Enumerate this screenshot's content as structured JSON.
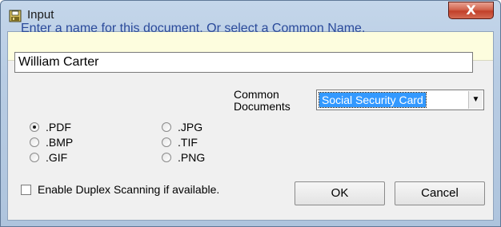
{
  "window": {
    "title": "Input",
    "close_glyph": "X"
  },
  "prompt": {
    "text": "Enter a name for this document.  Or select a Common Name."
  },
  "name_field": {
    "value": "William Carter"
  },
  "formats": {
    "col1": [
      {
        "label": ".PDF",
        "selected": true
      },
      {
        "label": ".BMP",
        "selected": false
      },
      {
        "label": ".GIF",
        "selected": false
      }
    ],
    "col2": [
      {
        "label": ".JPG",
        "selected": false
      },
      {
        "label": ".TIF",
        "selected": false
      },
      {
        "label": ".PNG",
        "selected": false
      }
    ]
  },
  "common": {
    "label_line1": "Common",
    "label_line2": "Documents",
    "selected": "Social Security Card"
  },
  "duplex": {
    "label": "Enable Duplex Scanning if available.",
    "checked": false
  },
  "buttons": {
    "ok": "OK",
    "cancel": "Cancel"
  },
  "icons": {
    "app": "scanner-floppy-icon",
    "dropdown": "chevron-down-icon"
  },
  "colors": {
    "prompt_text": "#2a4a9a",
    "prompt_bg": "#fdfdde",
    "selection": "#3399ff",
    "close_button": "#c2402a"
  }
}
